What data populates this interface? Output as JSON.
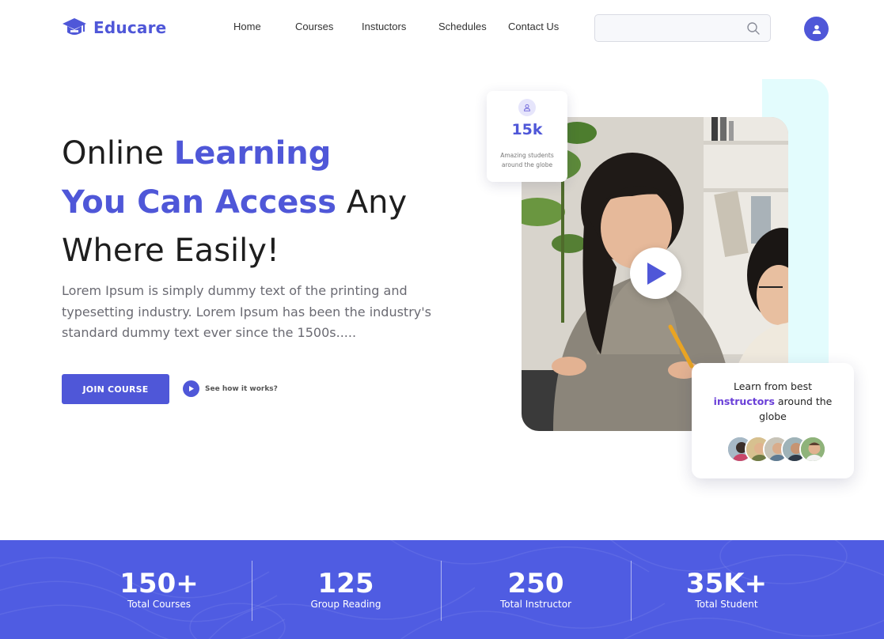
{
  "brand": {
    "name": "Educare",
    "color": "#4f57d8"
  },
  "nav": {
    "items": [
      "Home",
      "Courses",
      "Instuctors",
      "Schedules",
      "Contact Us"
    ]
  },
  "search": {
    "placeholder": "",
    "value": "",
    "icon": "search-icon"
  },
  "user": {
    "icon": "user-icon"
  },
  "hero": {
    "line1_plain": "Online ",
    "line1_accent": "Learning",
    "line2_accent": "You Can Access",
    "line2_plain": " Any",
    "line3": "Where Easily!",
    "description": "Lorem Ipsum is simply dummy text of the printing and typesetting industry. Lorem Ipsum has been the industry's standard dummy text ever since the 1500s.....",
    "join_label": "JOIN COURSE",
    "how_label": "See how it works?"
  },
  "stat_card": {
    "value": "15k",
    "subtitle": "Amazing students around the globe",
    "icon": "user-icon"
  },
  "learn_card": {
    "prefix": "Learn from best",
    "highlight": "instructors",
    "suffix": "around the globe"
  },
  "stats": [
    {
      "value": "150+",
      "label": "Total Courses"
    },
    {
      "value": "125",
      "label": "Group Reading"
    },
    {
      "value": "250",
      "label": "Total Instructor"
    },
    {
      "value": "35K+",
      "label": "Total Student"
    }
  ],
  "colors": {
    "accent": "#4f57d8",
    "band": "#4f5ce2",
    "highlight": "#6a3fd8",
    "cyan": "#e3fcfd"
  }
}
